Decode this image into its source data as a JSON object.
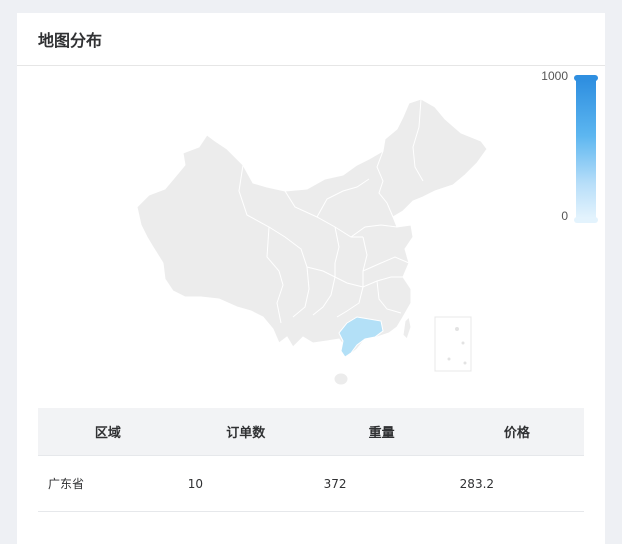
{
  "card": {
    "title": "地图分布"
  },
  "visual_map": {
    "max_label": "1000",
    "min_label": "0",
    "colors": {
      "high": "#2f8fe0",
      "low": "#e3f3fd",
      "region_default": "#ececec",
      "region_border": "#ffffff",
      "highlight": "#b3e0f7"
    }
  },
  "map": {
    "highlighted_region": "广东省",
    "highlighted_value": 10
  },
  "table": {
    "headers": [
      "区域",
      "订单数",
      "重量",
      "价格"
    ],
    "rows": [
      [
        "广东省",
        "10",
        "372",
        "283.2"
      ]
    ]
  }
}
